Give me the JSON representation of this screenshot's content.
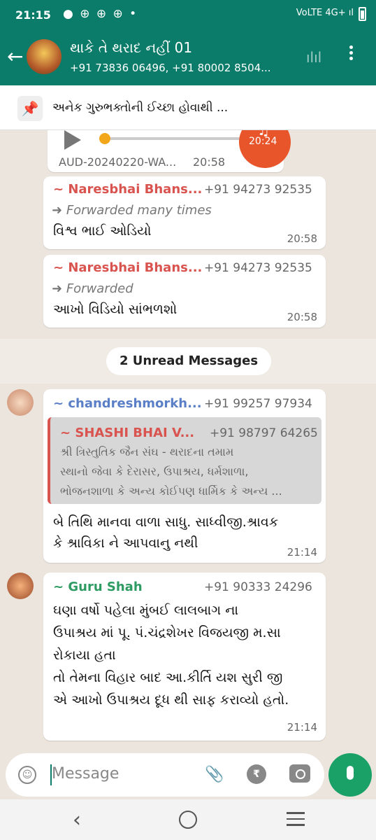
{
  "status_bar": {
    "time": "21:15",
    "icons": "● ⊕ ⊕ ⊕ •",
    "network": "4G+",
    "network_label": "VoLTE"
  },
  "header": {
    "title": "થાકે તે થરાદ નહીં 01",
    "subtitle": "+91 73836 06496, +91 80002 8504..."
  },
  "pinned": {
    "text": "અનેક ગુરુભક્તોની ઈચ્છા હોવાથી ..."
  },
  "audio": {
    "name": "AUD-20240220-WA...",
    "time": "20:58",
    "duration": "20:24"
  },
  "messages": [
    {
      "sender": "~ Naresbhai Bhans...",
      "phone": "+91 94273 92535",
      "forward": "Forwarded many times",
      "text": "વિશ્વ ભાઈ ઓડિયો",
      "time": "20:58"
    },
    {
      "sender": "~ Naresbhai Bhans...",
      "phone": "+91 94273 92535",
      "forward": "Forwarded",
      "text": "આખો વિડિયો સાંભળશો",
      "time": "20:58"
    }
  ],
  "unread_label": "2 Unread Messages",
  "msg3": {
    "sender": "~ chandreshmorkh...",
    "phone": "+91 99257 97934",
    "quote_sender": "~ SHASHI BHAI V...",
    "quote_phone": "+91 98797 64265",
    "quote_lines": [
      "શ્રી ત્રિસ્તુતિક જૈન સંઘ - થરાદના તમામ",
      "સ્થાનો જેવા કે દેરાસર, ઉપાશ્રય, ધર્મશાળા,",
      "ભોજનશાળા કે અન્ય કોઈપણ ધાર્મિક કે અન્ય ..."
    ],
    "lines": [
      "બે તિથિ માનવા વાળા સાધુ. સાધ્વીજી.શ્રાવક",
      "કે શ્રાવિકા ને આપવાનુ નથી"
    ],
    "time": "21:14"
  },
  "msg4": {
    "sender": "~ Guru Shah",
    "phone": "+91 90333 24296",
    "lines": [
      "ઘણા વર્ષો પહેલા મુંબઈ લાલબાગ ના",
      "ઉપાશ્રય માં પૂ. પં.ચંદ્રશેખર વિજયજી મ.સા",
      "રોકાયા હતા",
      "તો તેમના વિહાર બાદ આ.કીર્તિ યશ સુરી જી",
      "એ આખો ઉપાશ્રય દૂધ થી સાફ કરાવ્યો હતો."
    ],
    "time": "21:14"
  },
  "input": {
    "placeholder": "Message"
  },
  "colors": {
    "header": "#0b7c6a",
    "mic": "#1aa168",
    "sender_red": "#d9534f",
    "sender_blue": "#5b7fc7",
    "sender_green": "#2e9b62"
  }
}
